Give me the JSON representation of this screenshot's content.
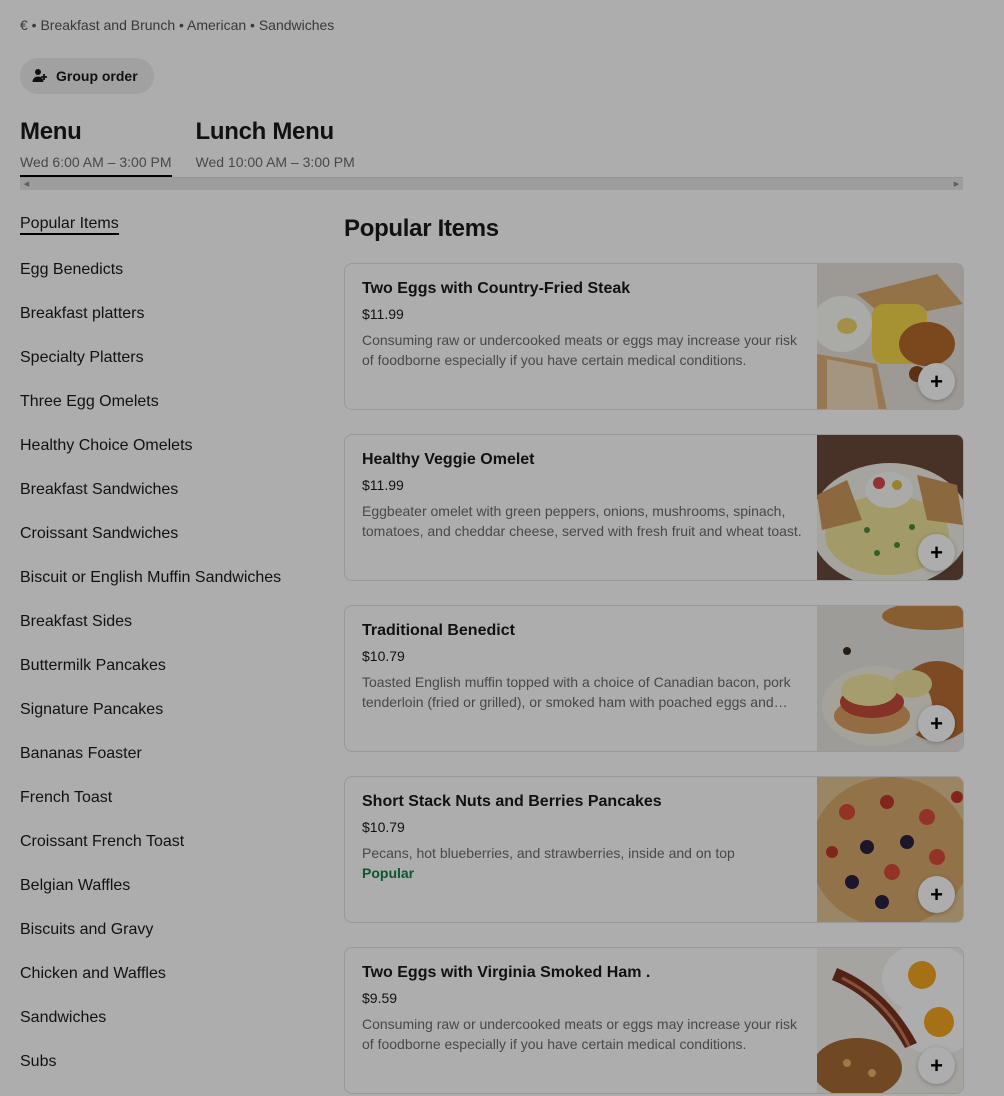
{
  "header": {
    "meta": "€ • Breakfast and Brunch • American • Sandwiches",
    "group_order_label": "Group order"
  },
  "menus": [
    {
      "title": "Menu",
      "hours": "Wed 6:00 AM – 3:00 PM",
      "active": true
    },
    {
      "title": "Lunch Menu",
      "hours": "Wed 10:00 AM – 3:00 PM",
      "active": false
    }
  ],
  "sidebar": {
    "items": [
      "Popular Items",
      "Egg Benedicts",
      "Breakfast platters",
      "Specialty Platters",
      "Three Egg Omelets",
      "Healthy Choice Omelets",
      "Breakfast Sandwiches",
      "Croissant Sandwiches",
      "Biscuit or English Muffin Sandwiches",
      "Breakfast Sides",
      "Buttermilk Pancakes",
      "Signature Pancakes",
      "Bananas Foaster",
      "French Toast",
      "Croissant French Toast",
      "Belgian Waffles",
      "Biscuits and Gravy",
      "Chicken and Waffles",
      "Sandwiches",
      "Subs"
    ]
  },
  "section": {
    "title": "Popular Items",
    "items": [
      {
        "name": "Two Eggs with Country-Fried Steak",
        "price": "$11.99",
        "description": "Consuming raw or undercooked meats or eggs may increase your risk of foodborne especially if you have certain medical conditions.",
        "badge": "",
        "image": "country-fried-steak-photo"
      },
      {
        "name": "Healthy Veggie Omelet",
        "price": "$11.99",
        "description": "Eggbeater omelet with green peppers, onions, mushrooms, spinach, tomatoes, and cheddar cheese, served with fresh fruit and wheat toast.",
        "badge": "",
        "image": "veggie-omelet-photo"
      },
      {
        "name": "Traditional Benedict",
        "price": "$10.79",
        "description": "Toasted English muffin topped with a choice of Canadian bacon, pork tenderloin (fried or grilled), or smoked ham with poached eggs and hollandaise sauce.",
        "badge": "",
        "image": "benedict-photo"
      },
      {
        "name": "Short Stack Nuts and Berries Pancakes",
        "price": "$10.79",
        "description": "Pecans, hot blueberries, and strawberries, inside and on top",
        "badge": "Popular",
        "image": "pancakes-photo"
      },
      {
        "name": "Two Eggs with Virginia Smoked Ham .",
        "price": "$9.59",
        "description": "Consuming raw or undercooked meats or eggs may increase your risk of foodborne especially if you have certain medical conditions.",
        "badge": "",
        "image": "eggs-ham-photo"
      }
    ]
  },
  "add_button_label": "+",
  "colors": {
    "popular_badge": "#0e8345",
    "overlay": "rgba(0,0,0,0.32)"
  }
}
